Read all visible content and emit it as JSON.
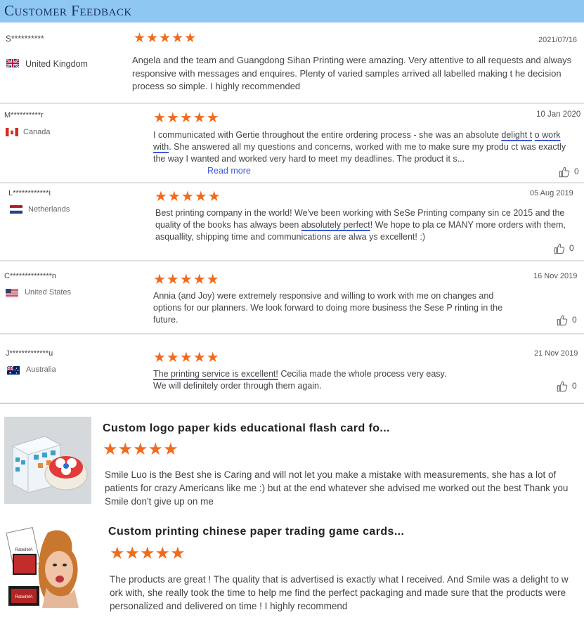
{
  "header": {
    "title": "Customer Feedback"
  },
  "reviews": [
    {
      "name": "S**********",
      "country": "United Kingdom",
      "date": "2021/07/16",
      "stars": "★★★★★",
      "text": "Angela and the team and Guangdong Sihan Printing were amazing. Very attentive to all requests and always responsive with messages and enquires. Plenty of varied samples arrived all labelled making t he decision process so simple. I highly recommended"
    },
    {
      "name": "M**********r",
      "country": "Canada",
      "date": "10 Jan 2020",
      "stars": "★★★★★",
      "text_a": "I communicated with Gertie throughout the entire ordering process - she was an absolute ",
      "text_u1": "delight t",
      "text_b": " ",
      "text_u2": "o work with",
      "text_c": ". She answered all my questions and concerns, worked with me to make sure my produ ct was exactly the way I wanted and worked very hard to meet my deadlines. The product it s...",
      "read_more": "Read more",
      "likes": "0"
    },
    {
      "name": "L************i",
      "country": "Netherlands",
      "date": "05 Aug 2019",
      "stars": "★★★★★",
      "text_a": "Best printing company in the world! We've been working with SeSe Printing company sin ce 2015 and the quality of the books has always been ",
      "text_u": "absolutely perfect",
      "text_b": "! We hope to pla ce MANY more orders with them, asquallity, shipping time and communications are alwa ys excellent! :)",
      "likes": "0"
    },
    {
      "name": "C**************n",
      "country": "United States",
      "date": "16 Nov 2019",
      "stars": "★★★★★",
      "text": "Annia (and Joy) were extremely responsive and willing to work with me on changes and options for our planners. We look forward to doing more business the            Sese P rinting in the future.",
      "likes": "0"
    },
    {
      "name": "J*************u",
      "country": "Australia",
      "date": "21 Nov 2019",
      "stars": "★★★★★",
      "text_u": "The printing service is excellent!",
      "text_a": " Cecilia made the whole process very easy.",
      "text_b": "We will definitely order through them again.",
      "likes": "0"
    }
  ],
  "products": [
    {
      "title": "Custom logo paper kids educational flash card fo...",
      "stars": "★★★★★",
      "text": "Smile Luo  is the Best  she is Caring and will not let you make a mistake with measurements, she has a lot of patients for crazy Americans like me :) but at the end whatever she advised me worked out the best Thank you Smile  don't give up on me"
    },
    {
      "title": "Custom printing chinese paper trading game cards...",
      "stars": "★★★★★",
      "text": "The products are great ! The quality that is advertised is exactly what I received. And Smile was a delight to w ork with, she really took the time to help me find the perfect packaging and made sure that the products were personalized and delivered on time ! I highly recommend",
      "box_text_1": "RatedMA",
      "box_text_2": "RatedMA"
    }
  ],
  "colors": {
    "header_bg": "#8ec7f2",
    "title": "#1b2f6b",
    "star": "#f26b1d",
    "underline": "#3d5bd6"
  },
  "icons": [
    "flag-uk-icon",
    "flag-canada-icon",
    "flag-netherlands-icon",
    "flag-us-icon",
    "flag-australia-icon",
    "thumbs-up-icon"
  ]
}
